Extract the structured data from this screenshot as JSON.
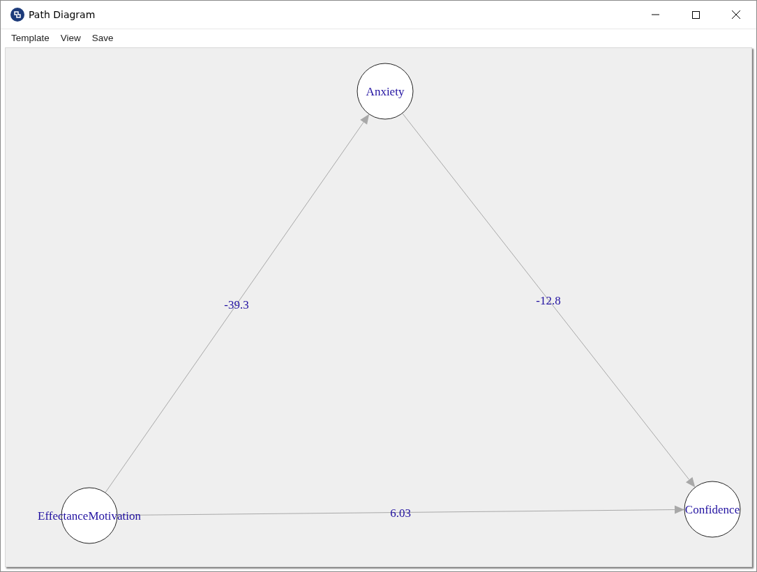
{
  "window": {
    "title": "Path Diagram"
  },
  "menu": [
    {
      "label": "Template"
    },
    {
      "label": "View"
    },
    {
      "label": "Save"
    }
  ],
  "diagram": {
    "nodes": [
      {
        "label": "Anxiety"
      },
      {
        "label": "EffectanceMotivation"
      },
      {
        "label": "Confidence"
      }
    ],
    "edges": [
      {
        "label": "-39.3"
      },
      {
        "label": "-12.8"
      },
      {
        "label": "6.03"
      }
    ]
  }
}
